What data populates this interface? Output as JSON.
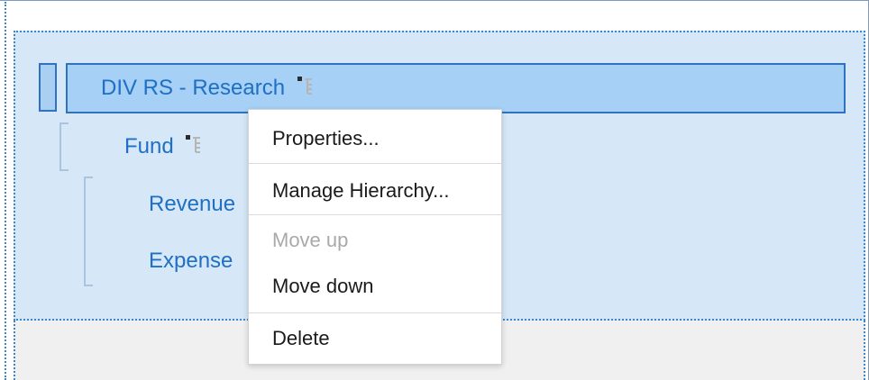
{
  "tree": {
    "root": {
      "label": "DIV RS - Research",
      "icon": "hierarchy-icon",
      "selected": true
    },
    "children": [
      {
        "label": "Fund",
        "icon": "hierarchy-icon",
        "children": [
          {
            "label": "Revenue"
          },
          {
            "label": "Expense"
          }
        ]
      }
    ]
  },
  "context_menu": {
    "items": [
      {
        "label": "Properties...",
        "enabled": true
      },
      {
        "label": "Manage Hierarchy...",
        "enabled": true
      },
      {
        "label": "Move up",
        "enabled": false
      },
      {
        "label": "Move down",
        "enabled": true
      },
      {
        "label": "Delete",
        "enabled": true
      }
    ]
  },
  "colors": {
    "selection_fill": "#a6d0f6",
    "selection_border": "#2f73c0",
    "drop_zone_fill": "#d6e8f8",
    "label_blue": "#1f6fc4",
    "disabled_text": "#a9a9a9"
  }
}
